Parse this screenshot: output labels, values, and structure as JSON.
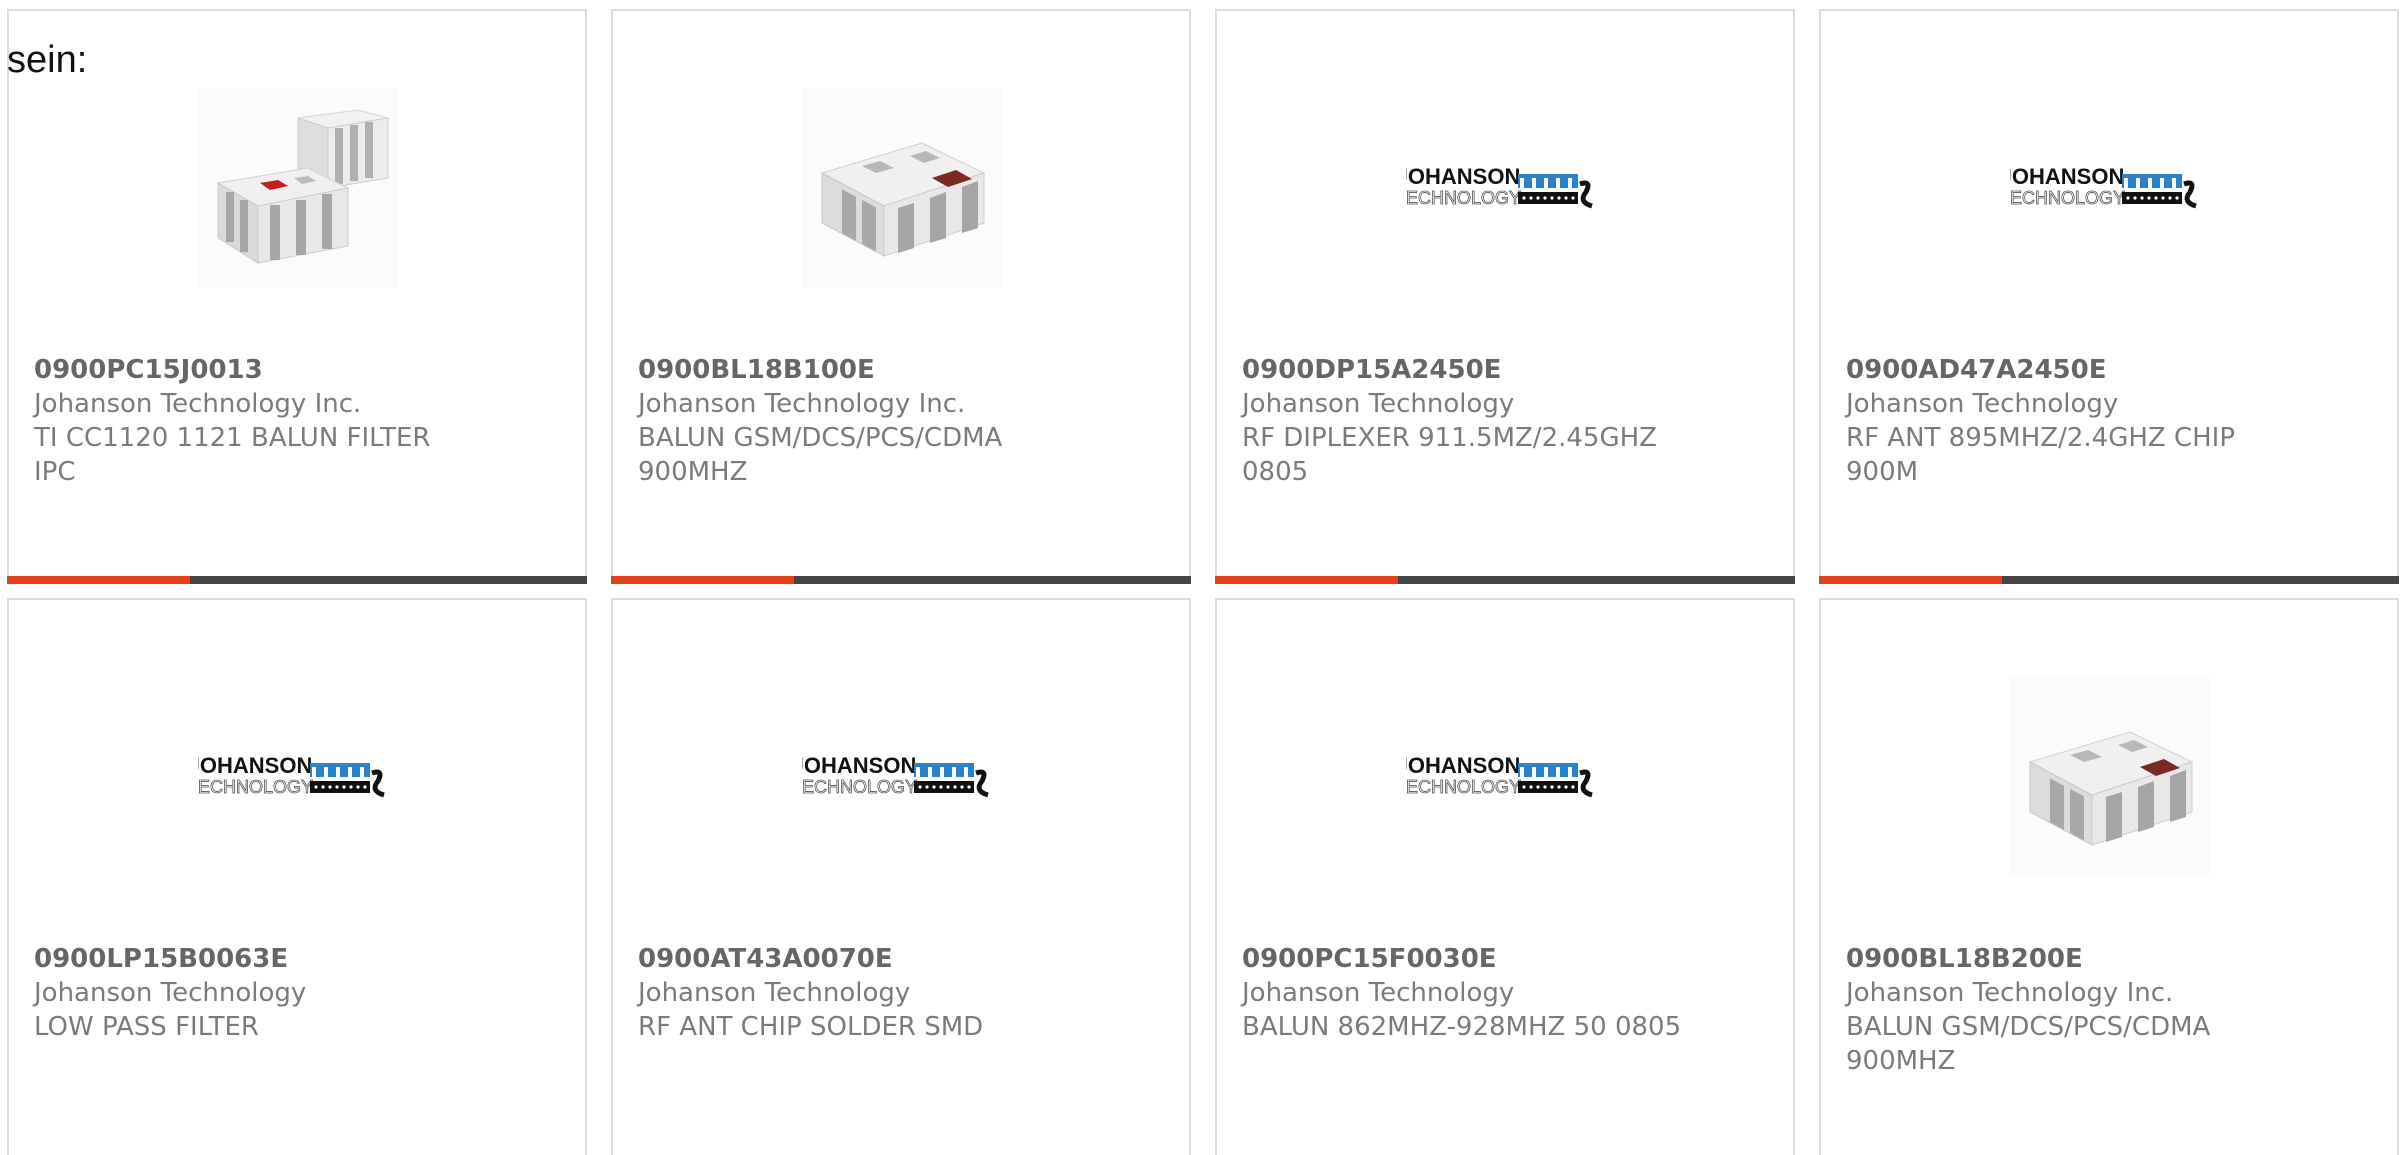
{
  "intro_text": "sein:",
  "colors": {
    "accent": "#e8401c",
    "bar_dark": "#444444",
    "card_border": "#dcdcdc",
    "text": "#7b7b7b"
  },
  "logo": {
    "line1": "JOHANSON",
    "line2": "TECHNOLOGY"
  },
  "products": [
    {
      "part": "0900PC15J0013",
      "manufacturer": "Johanson Technology Inc.",
      "desc1": "TI CC1120 1121 BALUN FILTER",
      "desc2": "IPC",
      "image": "chip-pair-photo"
    },
    {
      "part": "0900BL18B100E",
      "manufacturer": "Johanson Technology Inc.",
      "desc1": "BALUN GSM/DCS/PCS/CDMA",
      "desc2": "900MHZ",
      "image": "chip-photo"
    },
    {
      "part": "0900DP15A2450E",
      "manufacturer": "Johanson Technology",
      "desc1": "RF DIPLEXER 911.5MZ/2.45GHZ",
      "desc2": "0805",
      "image": "johanson-logo"
    },
    {
      "part": "0900AD47A2450E",
      "manufacturer": "Johanson Technology",
      "desc1": "RF ANT 895MHZ/2.4GHZ CHIP",
      "desc2": "900M",
      "image": "johanson-logo"
    },
    {
      "part": "0900LP15B0063E",
      "manufacturer": "Johanson Technology",
      "desc1": "LOW PASS FILTER",
      "desc2": "",
      "image": "johanson-logo"
    },
    {
      "part": "0900AT43A0070E",
      "manufacturer": "Johanson Technology",
      "desc1": "RF ANT CHIP SOLDER SMD",
      "desc2": "",
      "image": "johanson-logo"
    },
    {
      "part": "0900PC15F0030E",
      "manufacturer": "Johanson Technology",
      "desc1": "BALUN 862MHZ-928MHZ 50 0805",
      "desc2": "",
      "image": "johanson-logo"
    },
    {
      "part": "0900BL18B200E",
      "manufacturer": "Johanson Technology Inc.",
      "desc1": "BALUN GSM/DCS/PCS/CDMA",
      "desc2": "900MHZ",
      "image": "chip-photo"
    }
  ]
}
